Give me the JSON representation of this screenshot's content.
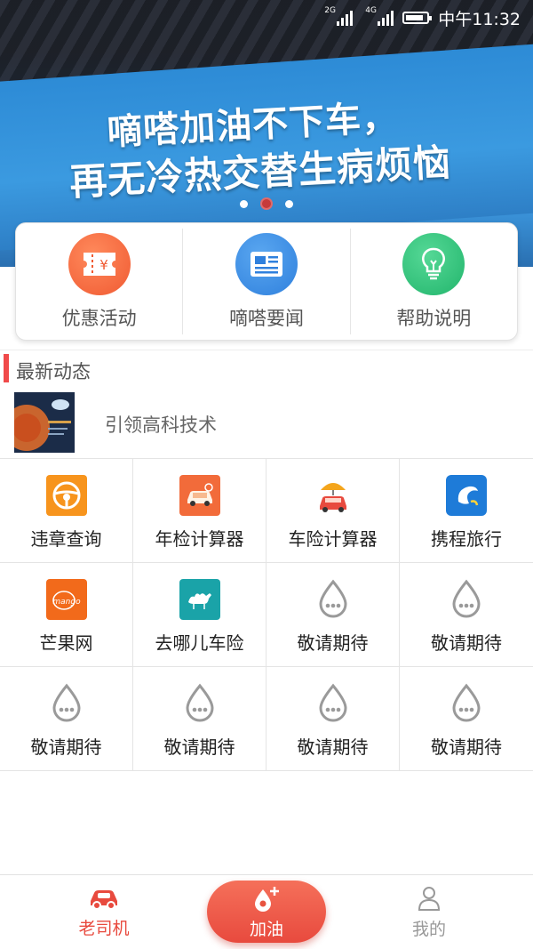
{
  "status_bar": {
    "network_1": "2G",
    "network_2": "4G",
    "time": "中午11:32",
    "battery_level": 0.85
  },
  "banner": {
    "line1": "嘀嗒加油不下车，",
    "line2": "再无冷热交替生病烦恼",
    "slide_count": 3,
    "active_slide": 2
  },
  "quick_actions": [
    {
      "label": "优惠活动",
      "icon": "coupon-icon",
      "color": "#f0643c"
    },
    {
      "label": "嘀嗒要闻",
      "icon": "news-icon",
      "color": "#3a8fe6"
    },
    {
      "label": "帮助说明",
      "icon": "lightbulb-icon",
      "color": "#2fc07a"
    }
  ],
  "section": {
    "title": "最新动态"
  },
  "news": {
    "title": "引领高科技术"
  },
  "services": [
    {
      "label": "违章查询",
      "icon": "steering-wheel-icon"
    },
    {
      "label": "年检计算器",
      "icon": "car-inspection-icon"
    },
    {
      "label": "车险计算器",
      "icon": "car-umbrella-icon"
    },
    {
      "label": "携程旅行",
      "icon": "ctrip-dolphin-icon"
    },
    {
      "label": "芒果网",
      "icon": "mango-logo-icon"
    },
    {
      "label": "去哪儿车险",
      "icon": "qunar-camel-icon"
    },
    {
      "label": "敬请期待",
      "icon": "droplet-placeholder-icon"
    },
    {
      "label": "敬请期待",
      "icon": "droplet-placeholder-icon"
    },
    {
      "label": "敬请期待",
      "icon": "droplet-placeholder-icon"
    },
    {
      "label": "敬请期待",
      "icon": "droplet-placeholder-icon"
    },
    {
      "label": "敬请期待",
      "icon": "droplet-placeholder-icon"
    },
    {
      "label": "敬请期待",
      "icon": "droplet-placeholder-icon"
    }
  ],
  "bottom_nav": {
    "driver": {
      "label": "老司机",
      "icon": "car-icon",
      "color": "#e84a3e"
    },
    "refuel": {
      "label": "加油",
      "icon": "droplet-plus-icon"
    },
    "mine": {
      "label": "我的",
      "icon": "person-icon",
      "color": "#999999"
    }
  },
  "colors": {
    "accent_red": "#f04a4a",
    "brand_blue": "#2d8bd6"
  }
}
